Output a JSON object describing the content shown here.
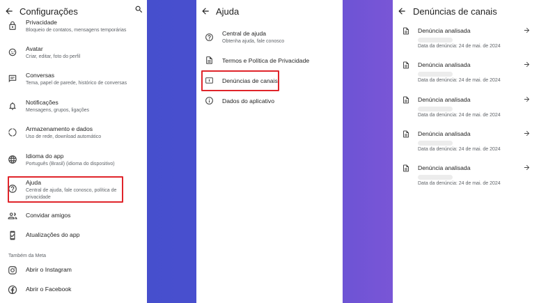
{
  "settings": {
    "title": "Configurações",
    "items": [
      {
        "title": "Privacidade",
        "subtitle": "Bloqueio de contatos, mensagens temporárias"
      },
      {
        "title": "Avatar",
        "subtitle": "Criar, editar, foto do perfil"
      },
      {
        "title": "Conversas",
        "subtitle": "Tema, papel de parede, histórico de conversas"
      },
      {
        "title": "Notificações",
        "subtitle": "Mensagens, grupos, ligações"
      },
      {
        "title": "Armazenamento e dados",
        "subtitle": "Uso de rede, download automático"
      },
      {
        "title": "Idioma do app",
        "subtitle": "Português (Brasil) (idioma do dispositivo)"
      },
      {
        "title": "Ajuda",
        "subtitle": "Central de ajuda, fale conosco, política de privacidade"
      },
      {
        "title": "Convidar amigos"
      },
      {
        "title": "Atualizações do app"
      }
    ],
    "section_label": "Também da Meta",
    "meta_items": [
      {
        "title": "Abrir o Instagram"
      },
      {
        "title": "Abrir o Facebook"
      }
    ]
  },
  "help": {
    "title": "Ajuda",
    "items": [
      {
        "title": "Central de ajuda",
        "subtitle": "Obtenha ajuda, fale conosco"
      },
      {
        "title": "Termos e Política de Privacidade"
      },
      {
        "title": "Denúncias de canais"
      },
      {
        "title": "Dados do aplicativo"
      }
    ]
  },
  "reports": {
    "title": "Denúncias de canais",
    "items": [
      {
        "title": "Denúncia analisada",
        "date": "Data da denúncia: 24 de mai. de 2024"
      },
      {
        "title": "Denúncia analisada",
        "date": "Data da denúncia: 24 de mai. de 2024"
      },
      {
        "title": "Denúncia analisada",
        "date": "Data da denúncia: 24 de mai. de 2024"
      },
      {
        "title": "Denúncia analisada",
        "date": "Data da denúncia: 24 de mai. de 2024"
      },
      {
        "title": "Denúncia analisada",
        "date": "Data da denúncia: 24 de mai. de 2024"
      }
    ]
  },
  "colors": {
    "highlight": "#e0242a",
    "background_gradient_start": "#3d4fc9",
    "background_gradient_end": "#8f5bdb"
  },
  "icons": [
    "back-arrow-icon",
    "search-icon",
    "lock-icon",
    "avatar-icon",
    "chat-icon",
    "bell-icon",
    "storage-icon",
    "globe-icon",
    "help-icon",
    "people-icon",
    "phone-update-icon",
    "instagram-icon",
    "facebook-icon",
    "document-icon",
    "report-icon",
    "info-icon",
    "arrow-right-icon"
  ]
}
